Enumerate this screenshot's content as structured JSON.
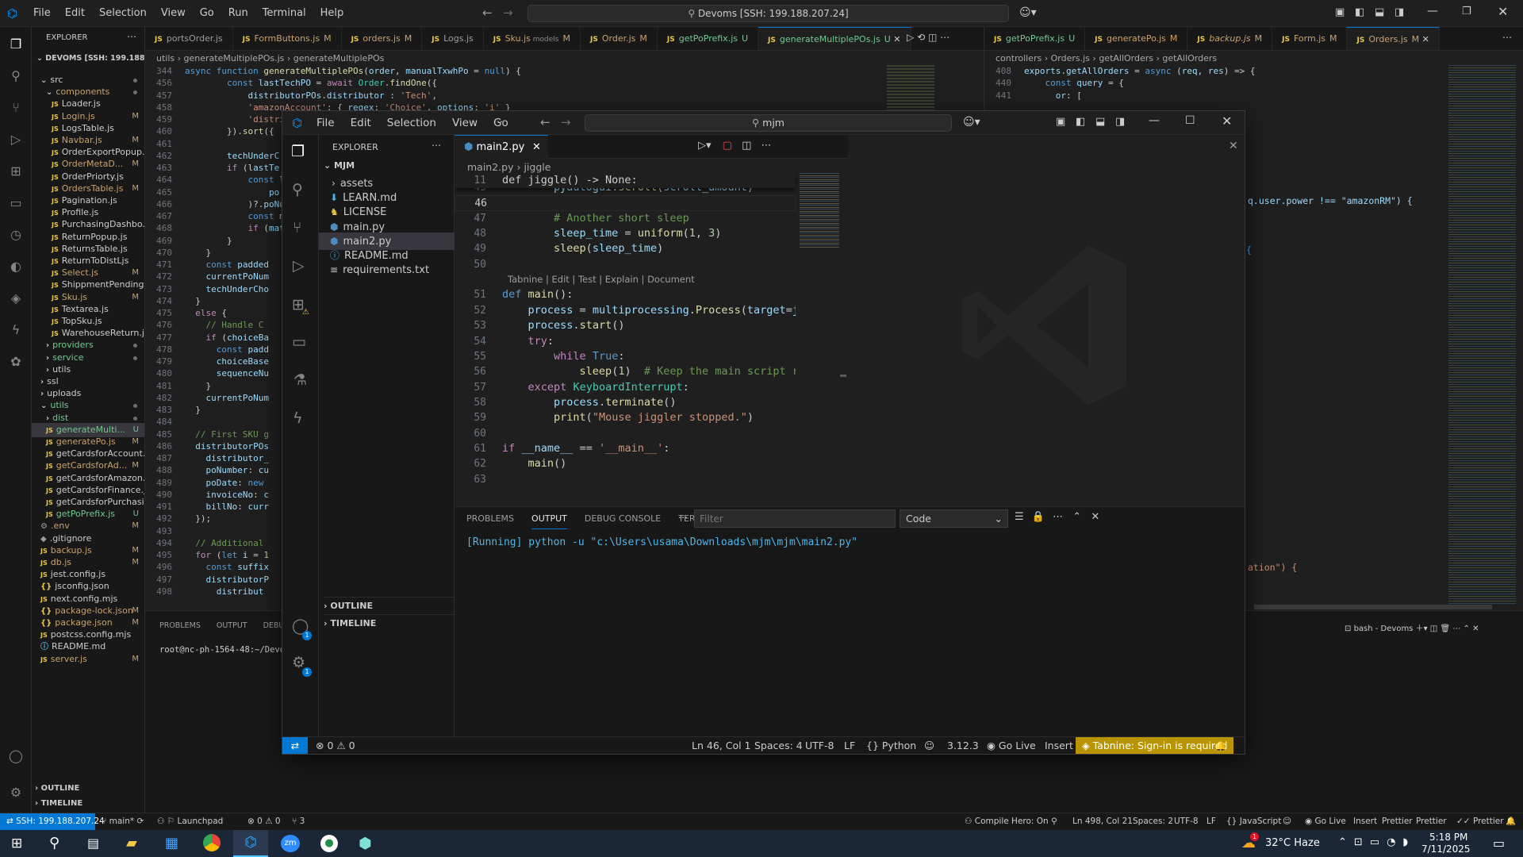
{
  "back_window": {
    "menu": [
      "File",
      "Edit",
      "Selection",
      "View",
      "Go",
      "Run",
      "Terminal",
      "Help"
    ],
    "search": "Devoms [SSH: 199.188.207.24]",
    "explorer_title": "EXPLORER",
    "root": "DEVOMS [SSH: 199.188.207.24]",
    "tree": [
      {
        "label": "src",
        "indent": 1,
        "kind": "folder-open",
        "badge": "dot"
      },
      {
        "label": "components",
        "indent": 2,
        "kind": "folder-open",
        "badge": "dot",
        "color": "#c9a26d"
      },
      {
        "label": "Loader.js",
        "indent": 3,
        "kind": "js",
        "badge": ""
      },
      {
        "label": "Login.js",
        "indent": 3,
        "kind": "js",
        "badge": "M"
      },
      {
        "label": "LogsTable.js",
        "indent": 3,
        "kind": "js",
        "badge": ""
      },
      {
        "label": "Navbar.js",
        "indent": 3,
        "kind": "js",
        "badge": "M"
      },
      {
        "label": "OrderExportPopup.js",
        "indent": 3,
        "kind": "js",
        "badge": ""
      },
      {
        "label": "OrderMetaD...",
        "indent": 3,
        "kind": "js",
        "badge": "M"
      },
      {
        "label": "OrderPriorty.js",
        "indent": 3,
        "kind": "js",
        "badge": ""
      },
      {
        "label": "OrdersTable.js",
        "indent": 3,
        "kind": "js",
        "badge": "M"
      },
      {
        "label": "Pagination.js",
        "indent": 3,
        "kind": "js",
        "badge": ""
      },
      {
        "label": "Profile.js",
        "indent": 3,
        "kind": "js",
        "badge": ""
      },
      {
        "label": "PurchasingDashbo...",
        "indent": 3,
        "kind": "js",
        "badge": ""
      },
      {
        "label": "ReturnPopup.js",
        "indent": 3,
        "kind": "js",
        "badge": ""
      },
      {
        "label": "ReturnsTable.js",
        "indent": 3,
        "kind": "js",
        "badge": ""
      },
      {
        "label": "ReturnToDistLjs",
        "indent": 3,
        "kind": "js",
        "badge": ""
      },
      {
        "label": "Select.js",
        "indent": 3,
        "kind": "js",
        "badge": "M"
      },
      {
        "label": "ShippmentPending...",
        "indent": 3,
        "kind": "js",
        "badge": ""
      },
      {
        "label": "Sku.js",
        "indent": 3,
        "kind": "js",
        "badge": "M"
      },
      {
        "label": "Textarea.js",
        "indent": 3,
        "kind": "js",
        "badge": ""
      },
      {
        "label": "TopSku.js",
        "indent": 3,
        "kind": "js",
        "badge": ""
      },
      {
        "label": "WarehouseReturn.js",
        "indent": 3,
        "kind": "js",
        "badge": ""
      },
      {
        "label": "providers",
        "indent": 2,
        "kind": "folder",
        "badge": "dot",
        "color": "#73c991"
      },
      {
        "label": "service",
        "indent": 2,
        "kind": "folder",
        "badge": "dot",
        "color": "#73c991"
      },
      {
        "label": "utils",
        "indent": 2,
        "kind": "folder",
        "badge": ""
      },
      {
        "label": "ssl",
        "indent": 1,
        "kind": "folder",
        "badge": ""
      },
      {
        "label": "uploads",
        "indent": 1,
        "kind": "folder",
        "badge": ""
      },
      {
        "label": "utils",
        "indent": 1,
        "kind": "folder-open",
        "badge": "dot",
        "color": "#73c991"
      },
      {
        "label": "dist",
        "indent": 2,
        "kind": "folder",
        "badge": "dot",
        "color": "#73c991"
      },
      {
        "label": "generateMulti...",
        "indent": 2,
        "kind": "js",
        "badge": "U",
        "active": true,
        "color": "#73c991"
      },
      {
        "label": "generatePo.js",
        "indent": 2,
        "kind": "js",
        "badge": "M"
      },
      {
        "label": "getCardsforAccount.js",
        "indent": 2,
        "kind": "js",
        "badge": ""
      },
      {
        "label": "getCardsforAd...",
        "indent": 2,
        "kind": "js",
        "badge": "M"
      },
      {
        "label": "getCardsforAmazon.js",
        "indent": 2,
        "kind": "js",
        "badge": ""
      },
      {
        "label": "getCardsforFinance.js",
        "indent": 2,
        "kind": "js",
        "badge": ""
      },
      {
        "label": "getCardsforPurchasi...",
        "indent": 2,
        "kind": "js",
        "badge": ""
      },
      {
        "label": "getPoPrefix.js",
        "indent": 2,
        "kind": "js",
        "badge": "U",
        "color": "#73c991"
      },
      {
        "label": ".env",
        "indent": 1,
        "kind": "gear",
        "badge": "M"
      },
      {
        "label": ".gitignore",
        "indent": 1,
        "kind": "diamond",
        "badge": ""
      },
      {
        "label": "backup.js",
        "indent": 1,
        "kind": "js",
        "badge": "M"
      },
      {
        "label": "db.js",
        "indent": 1,
        "kind": "js",
        "badge": "M"
      },
      {
        "label": "jest.config.js",
        "indent": 1,
        "kind": "js",
        "badge": ""
      },
      {
        "label": "jsconfig.json",
        "indent": 1,
        "kind": "json",
        "badge": ""
      },
      {
        "label": "next.config.mjs",
        "indent": 1,
        "kind": "js",
        "badge": ""
      },
      {
        "label": "package-lock.json",
        "indent": 1,
        "kind": "json",
        "badge": "M"
      },
      {
        "label": "package.json",
        "indent": 1,
        "kind": "json",
        "badge": "M"
      },
      {
        "label": "postcss.config.mjs",
        "indent": 1,
        "kind": "js",
        "badge": ""
      },
      {
        "label": "README.md",
        "indent": 1,
        "kind": "info",
        "badge": ""
      },
      {
        "label": "server.js",
        "indent": 1,
        "kind": "js",
        "badge": "M"
      }
    ],
    "outline": "OUTLINE",
    "timeline": "TIMELINE",
    "tabs_left": [
      {
        "label": "portsOrder.js",
        "m": ""
      },
      {
        "label": "FormButtons.js",
        "m": "M"
      },
      {
        "label": "orders.js",
        "m": "M"
      },
      {
        "label": "Logs.js",
        "m": ""
      },
      {
        "label": "Sku.js",
        "extra": "models",
        "m": "M"
      },
      {
        "label": "Order.js",
        "m": "M"
      },
      {
        "label": "getPoPrefix.js",
        "m": "U"
      },
      {
        "label": "generateMultiplePOs.js",
        "m": "U",
        "active": true
      }
    ],
    "tabs_right": [
      {
        "label": "getPoPrefix.js",
        "m": "U"
      },
      {
        "label": "generatePo.js",
        "m": "M"
      },
      {
        "label": "backup.js",
        "m": "M"
      },
      {
        "label": "Form.js",
        "m": "M"
      },
      {
        "label": "Orders.js",
        "m": "M",
        "active": true
      }
    ],
    "breadcrumb_left": [
      "utils",
      ">",
      "generateMultiplePOs.js",
      ">",
      "generateMultiplePOs"
    ],
    "breadcrumb_right": [
      "controllers",
      ">",
      "Orders.js",
      ">",
      "getAllOrders",
      ">",
      "getAllOrders"
    ],
    "code_left": [
      {
        "n": "344",
        "t": "async function generateMultiplePOs(order, manualTxwhPo = null) {"
      },
      {
        "n": "456",
        "t": "        const lastTechPO = await Order.findOne({"
      },
      {
        "n": "457",
        "t": "            distributorPOs.distributor : 'Tech',"
      },
      {
        "n": "458",
        "t": "            'amazonAccount': { $regex: 'Choice', $options: 'i' }"
      },
      {
        "n": "459",
        "t": "            'distrib"
      },
      {
        "n": "460",
        "t": "        }).sort({"
      },
      {
        "n": "461",
        "t": ""
      },
      {
        "n": "462",
        "t": "        techUnderC"
      },
      {
        "n": "463",
        "t": "        if (lastTe"
      },
      {
        "n": "464",
        "t": "            const la"
      },
      {
        "n": "465",
        "t": "                po =>"
      },
      {
        "n": "466",
        "t": "            )?.poNum"
      },
      {
        "n": "467",
        "t": "            const ma"
      },
      {
        "n": "468",
        "t": "            if (matc"
      },
      {
        "n": "469",
        "t": "        }"
      },
      {
        "n": "470",
        "t": "    }"
      },
      {
        "n": "471",
        "t": "    const padded"
      },
      {
        "n": "472",
        "t": "    currentPoNum"
      },
      {
        "n": "473",
        "t": "    techUnderCho"
      },
      {
        "n": "474",
        "t": "  }"
      },
      {
        "n": "475",
        "t": "  else {"
      },
      {
        "n": "476",
        "t": "    // Handle C"
      },
      {
        "n": "477",
        "t": "    if (choiceBa"
      },
      {
        "n": "478",
        "t": "      const padd"
      },
      {
        "n": "479",
        "t": "      choiceBase"
      },
      {
        "n": "480",
        "t": "      sequenceNu"
      },
      {
        "n": "481",
        "t": "    }"
      },
      {
        "n": "482",
        "t": "    currentPoNum"
      },
      {
        "n": "483",
        "t": "  }"
      },
      {
        "n": "484",
        "t": ""
      },
      {
        "n": "485",
        "t": "  // First SKU g"
      },
      {
        "n": "486",
        "t": "  distributorPOs"
      },
      {
        "n": "487",
        "t": "    distributor_"
      },
      {
        "n": "488",
        "t": "    poNumber: cu"
      },
      {
        "n": "489",
        "t": "    poDate: new"
      },
      {
        "n": "490",
        "t": "    invoiceNo: c"
      },
      {
        "n": "491",
        "t": "    billNo: curr"
      },
      {
        "n": "492",
        "t": "  });"
      },
      {
        "n": "493",
        "t": ""
      },
      {
        "n": "494",
        "t": "  // Additional"
      },
      {
        "n": "495",
        "t": "  for (let i = 1"
      },
      {
        "n": "496",
        "t": "    const suffix"
      },
      {
        "n": "497",
        "t": "    distributorP"
      },
      {
        "n": "498",
        "t": "      distribut"
      }
    ],
    "code_right": [
      {
        "n": "408",
        "t": "exports.getAllOrders = async (req, res) => {"
      },
      {
        "n": "440",
        "t": "    const query = {"
      },
      {
        "n": "441",
        "t": "      $or: ["
      }
    ],
    "right_fragments": [
      "q.user.power !== \"amazonRM\") {",
      "{",
      "ation\") {"
    ],
    "panel_tabs": [
      "PROBLEMS",
      "OUTPUT",
      "DEBUG C"
    ],
    "terminal_prompt": "root@nc-ph-1564-48:~/Devom",
    "terminal_label": "bash - Devoms",
    "status": {
      "remote": "SSH: 199.188.207.24",
      "branch": "main*",
      "launchpad": "Launchpad",
      "errors": "0",
      "warnings": "0",
      "ports": "3",
      "compile": "Compile Hero: On",
      "position": "Ln 498, Col 21",
      "spaces": "Spaces: 2",
      "encoding": "UTF-8",
      "eol": "LF",
      "language": "JavaScript",
      "golive": "Go Live",
      "insert": "Insert",
      "prettier1": "Prettier",
      "prettier2": "Prettier",
      "prettier3": "Prettier"
    }
  },
  "front_window": {
    "menu": [
      "File",
      "Edit",
      "Selection",
      "View",
      "Go"
    ],
    "search": "mjm",
    "explorer_title": "EXPLORER",
    "root": "MJM",
    "files": [
      {
        "label": "assets",
        "kind": "folder"
      },
      {
        "label": "LEARN.md",
        "kind": "md"
      },
      {
        "label": "LICENSE",
        "kind": "license"
      },
      {
        "label": "main.py",
        "kind": "py"
      },
      {
        "label": "main2.py",
        "kind": "py",
        "active": true
      },
      {
        "label": "README.md",
        "kind": "info"
      },
      {
        "label": "requirements.txt",
        "kind": "txt"
      }
    ],
    "outline": "OUTLINE",
    "timeline": "TIMELINE",
    "tab": "main2.py",
    "breadcrumb": [
      "main2.py",
      ">",
      "jiggle"
    ],
    "sticky": {
      "n": "11",
      "t": "def jiggle() -> None:"
    },
    "code": [
      {
        "n": "45",
        "t": "        pyautogui.scroll(scroll_amount)"
      },
      {
        "n": "46",
        "t": ""
      },
      {
        "n": "47",
        "t": "        # Another short sleep"
      },
      {
        "n": "48",
        "t": "        sleep_time = uniform(1, 3)"
      },
      {
        "n": "49",
        "t": "        sleep(sleep_time)"
      },
      {
        "n": "50",
        "t": ""
      },
      {
        "n": "",
        "t": "Tabnine | Edit | Test | Explain | Document",
        "lens": true
      },
      {
        "n": "51",
        "t": "def main():"
      },
      {
        "n": "52",
        "t": "    process = multiprocessing.Process(target=ji"
      },
      {
        "n": "53",
        "t": "    process.start()"
      },
      {
        "n": "54",
        "t": "    try:"
      },
      {
        "n": "55",
        "t": "        while True:"
      },
      {
        "n": "56",
        "t": "            sleep(1)  # Keep the main script ru"
      },
      {
        "n": "57",
        "t": "    except KeyboardInterrupt:"
      },
      {
        "n": "58",
        "t": "        process.terminate()"
      },
      {
        "n": "59",
        "t": "        print(\"Mouse jiggler stopped.\")"
      },
      {
        "n": "60",
        "t": ""
      },
      {
        "n": "61",
        "t": "if __name__ == '__main__':"
      },
      {
        "n": "62",
        "t": "    main()"
      },
      {
        "n": "63",
        "t": ""
      }
    ],
    "panel_tabs": [
      "PROBLEMS",
      "OUTPUT",
      "DEBUG CONSOLE",
      "TERMINAL"
    ],
    "panel_active": "OUTPUT",
    "filter_placeholder": "Filter",
    "output_channel": "Code",
    "output_text": "[Running] python -u \"c:\\Users\\usama\\Downloads\\mjm\\mjm\\main2.py\"",
    "accounts_badge": "1",
    "settings_badge": "1",
    "status": {
      "errors": "0",
      "warnings": "0",
      "position": "Ln 46, Col 1",
      "spaces": "Spaces: 4",
      "encoding": "UTF-8",
      "eol": "LF",
      "language": "Python",
      "version": "3.12.3",
      "golive": "Go Live",
      "insert": "Insert",
      "tabnine": "Tabnine: Sign-in is required"
    }
  },
  "taskbar": {
    "temperature": "32°C",
    "weather": "Haze",
    "time": "5:18 PM",
    "date": "7/11/2025",
    "weather_badge": "1"
  },
  "colors": {
    "accent": "#0078d4",
    "modified": "#c9a26d",
    "untracked": "#73c991",
    "tabnine_bg": "#b89500"
  }
}
